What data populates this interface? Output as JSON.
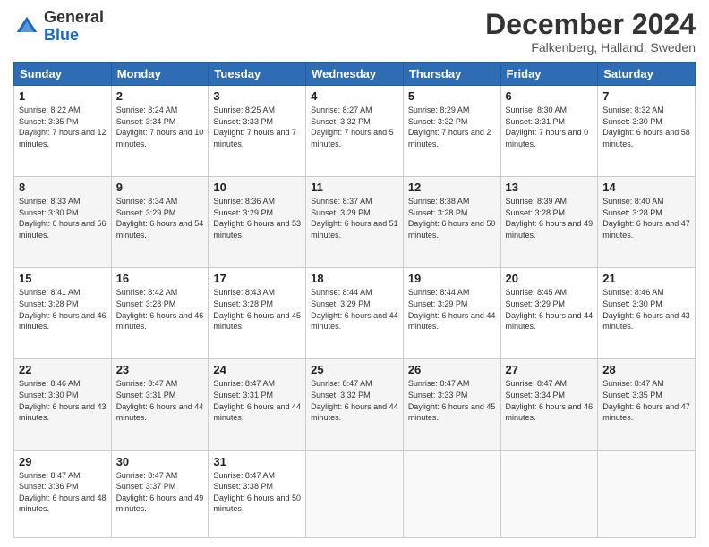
{
  "logo": {
    "general": "General",
    "blue": "Blue"
  },
  "header": {
    "month": "December 2024",
    "location": "Falkenberg, Halland, Sweden"
  },
  "weekdays": [
    "Sunday",
    "Monday",
    "Tuesday",
    "Wednesday",
    "Thursday",
    "Friday",
    "Saturday"
  ],
  "weeks": [
    [
      {
        "day": "1",
        "sunrise": "8:22 AM",
        "sunset": "3:35 PM",
        "daylight": "7 hours and 12 minutes."
      },
      {
        "day": "2",
        "sunrise": "8:24 AM",
        "sunset": "3:34 PM",
        "daylight": "7 hours and 10 minutes."
      },
      {
        "day": "3",
        "sunrise": "8:25 AM",
        "sunset": "3:33 PM",
        "daylight": "7 hours and 7 minutes."
      },
      {
        "day": "4",
        "sunrise": "8:27 AM",
        "sunset": "3:32 PM",
        "daylight": "7 hours and 5 minutes."
      },
      {
        "day": "5",
        "sunrise": "8:29 AM",
        "sunset": "3:32 PM",
        "daylight": "7 hours and 2 minutes."
      },
      {
        "day": "6",
        "sunrise": "8:30 AM",
        "sunset": "3:31 PM",
        "daylight": "7 hours and 0 minutes."
      },
      {
        "day": "7",
        "sunrise": "8:32 AM",
        "sunset": "3:30 PM",
        "daylight": "6 hours and 58 minutes."
      }
    ],
    [
      {
        "day": "8",
        "sunrise": "8:33 AM",
        "sunset": "3:30 PM",
        "daylight": "6 hours and 56 minutes."
      },
      {
        "day": "9",
        "sunrise": "8:34 AM",
        "sunset": "3:29 PM",
        "daylight": "6 hours and 54 minutes."
      },
      {
        "day": "10",
        "sunrise": "8:36 AM",
        "sunset": "3:29 PM",
        "daylight": "6 hours and 53 minutes."
      },
      {
        "day": "11",
        "sunrise": "8:37 AM",
        "sunset": "3:29 PM",
        "daylight": "6 hours and 51 minutes."
      },
      {
        "day": "12",
        "sunrise": "8:38 AM",
        "sunset": "3:28 PM",
        "daylight": "6 hours and 50 minutes."
      },
      {
        "day": "13",
        "sunrise": "8:39 AM",
        "sunset": "3:28 PM",
        "daylight": "6 hours and 49 minutes."
      },
      {
        "day": "14",
        "sunrise": "8:40 AM",
        "sunset": "3:28 PM",
        "daylight": "6 hours and 47 minutes."
      }
    ],
    [
      {
        "day": "15",
        "sunrise": "8:41 AM",
        "sunset": "3:28 PM",
        "daylight": "6 hours and 46 minutes."
      },
      {
        "day": "16",
        "sunrise": "8:42 AM",
        "sunset": "3:28 PM",
        "daylight": "6 hours and 46 minutes."
      },
      {
        "day": "17",
        "sunrise": "8:43 AM",
        "sunset": "3:28 PM",
        "daylight": "6 hours and 45 minutes."
      },
      {
        "day": "18",
        "sunrise": "8:44 AM",
        "sunset": "3:29 PM",
        "daylight": "6 hours and 44 minutes."
      },
      {
        "day": "19",
        "sunrise": "8:44 AM",
        "sunset": "3:29 PM",
        "daylight": "6 hours and 44 minutes."
      },
      {
        "day": "20",
        "sunrise": "8:45 AM",
        "sunset": "3:29 PM",
        "daylight": "6 hours and 44 minutes."
      },
      {
        "day": "21",
        "sunrise": "8:46 AM",
        "sunset": "3:30 PM",
        "daylight": "6 hours and 43 minutes."
      }
    ],
    [
      {
        "day": "22",
        "sunrise": "8:46 AM",
        "sunset": "3:30 PM",
        "daylight": "6 hours and 43 minutes."
      },
      {
        "day": "23",
        "sunrise": "8:47 AM",
        "sunset": "3:31 PM",
        "daylight": "6 hours and 44 minutes."
      },
      {
        "day": "24",
        "sunrise": "8:47 AM",
        "sunset": "3:31 PM",
        "daylight": "6 hours and 44 minutes."
      },
      {
        "day": "25",
        "sunrise": "8:47 AM",
        "sunset": "3:32 PM",
        "daylight": "6 hours and 44 minutes."
      },
      {
        "day": "26",
        "sunrise": "8:47 AM",
        "sunset": "3:33 PM",
        "daylight": "6 hours and 45 minutes."
      },
      {
        "day": "27",
        "sunrise": "8:47 AM",
        "sunset": "3:34 PM",
        "daylight": "6 hours and 46 minutes."
      },
      {
        "day": "28",
        "sunrise": "8:47 AM",
        "sunset": "3:35 PM",
        "daylight": "6 hours and 47 minutes."
      }
    ],
    [
      {
        "day": "29",
        "sunrise": "8:47 AM",
        "sunset": "3:36 PM",
        "daylight": "6 hours and 48 minutes."
      },
      {
        "day": "30",
        "sunrise": "8:47 AM",
        "sunset": "3:37 PM",
        "daylight": "6 hours and 49 minutes."
      },
      {
        "day": "31",
        "sunrise": "8:47 AM",
        "sunset": "3:38 PM",
        "daylight": "6 hours and 50 minutes."
      },
      null,
      null,
      null,
      null
    ]
  ],
  "labels": {
    "sunrise": "Sunrise:",
    "sunset": "Sunset:",
    "daylight": "Daylight:"
  }
}
